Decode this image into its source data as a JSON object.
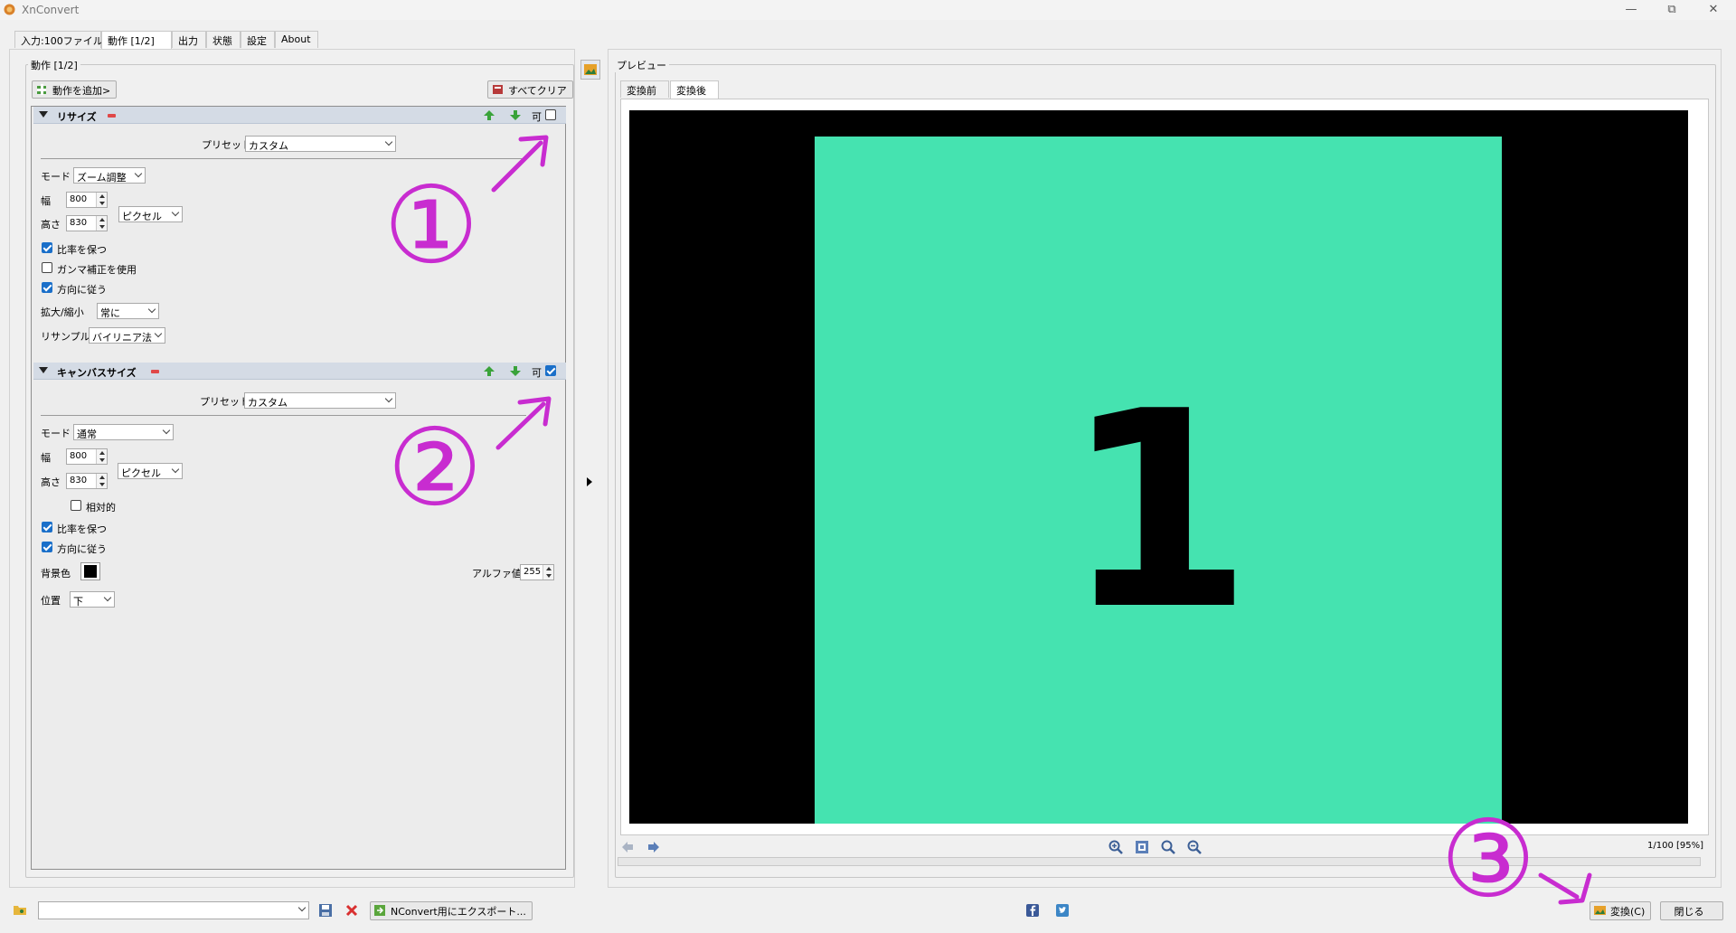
{
  "window": {
    "title": "XnConvert"
  },
  "tabs": [
    "入力:100ファイル",
    "動作 [1/2]",
    "出力",
    "状態",
    "設定",
    "About"
  ],
  "left": {
    "group_label": "動作 [1/2]",
    "add_action": "動作を追加>",
    "clear_all": "すべてクリア",
    "resize": {
      "title": "リサイズ",
      "enable_label": "可",
      "enabled": false,
      "preset_label": "プリセット",
      "preset_value": "カスタム",
      "mode_label": "モード",
      "mode_value": "ズーム調整",
      "width_label": "幅",
      "width_value": "800",
      "height_label": "高さ",
      "height_value": "830",
      "unit_value": "ピクセル",
      "keep_ratio": "比率を保つ",
      "keep_ratio_checked": true,
      "gamma": "ガンマ補正を使用",
      "gamma_checked": false,
      "orientation": "方向に従う",
      "orientation_checked": true,
      "scale_label": "拡大/縮小",
      "scale_value": "常に",
      "resample_label": "リサンプル",
      "resample_value": "バイリニア法"
    },
    "canvas": {
      "title": "キャンバスサイズ",
      "enable_label": "可",
      "enabled": true,
      "preset_label": "プリセット",
      "preset_value": "カスタム",
      "mode_label": "モード",
      "mode_value": "通常",
      "width_label": "幅",
      "width_value": "800",
      "height_label": "高さ",
      "height_value": "830",
      "unit_value": "ピクセル",
      "relative": "相対的",
      "relative_checked": false,
      "keep_ratio": "比率を保つ",
      "keep_ratio_checked": true,
      "orientation": "方向に従う",
      "orientation_checked": true,
      "bg_label": "背景色",
      "bg_color": "#000000",
      "alpha_label": "アルファ値",
      "alpha_value": "255",
      "position_label": "位置",
      "position_value": "下"
    }
  },
  "preview": {
    "label": "プレビュー",
    "tabs": [
      "変換前",
      "変換後"
    ],
    "active_tab": "変換後",
    "image_text": "1",
    "image_bg": "#45e3b0",
    "counter": "1/100 [95%]"
  },
  "annotations": {
    "one": "①",
    "two": "②",
    "three": "③"
  },
  "bottom": {
    "export": "NConvert用にエクスポート...",
    "convert": "変換(C)",
    "close": "閉じる"
  }
}
